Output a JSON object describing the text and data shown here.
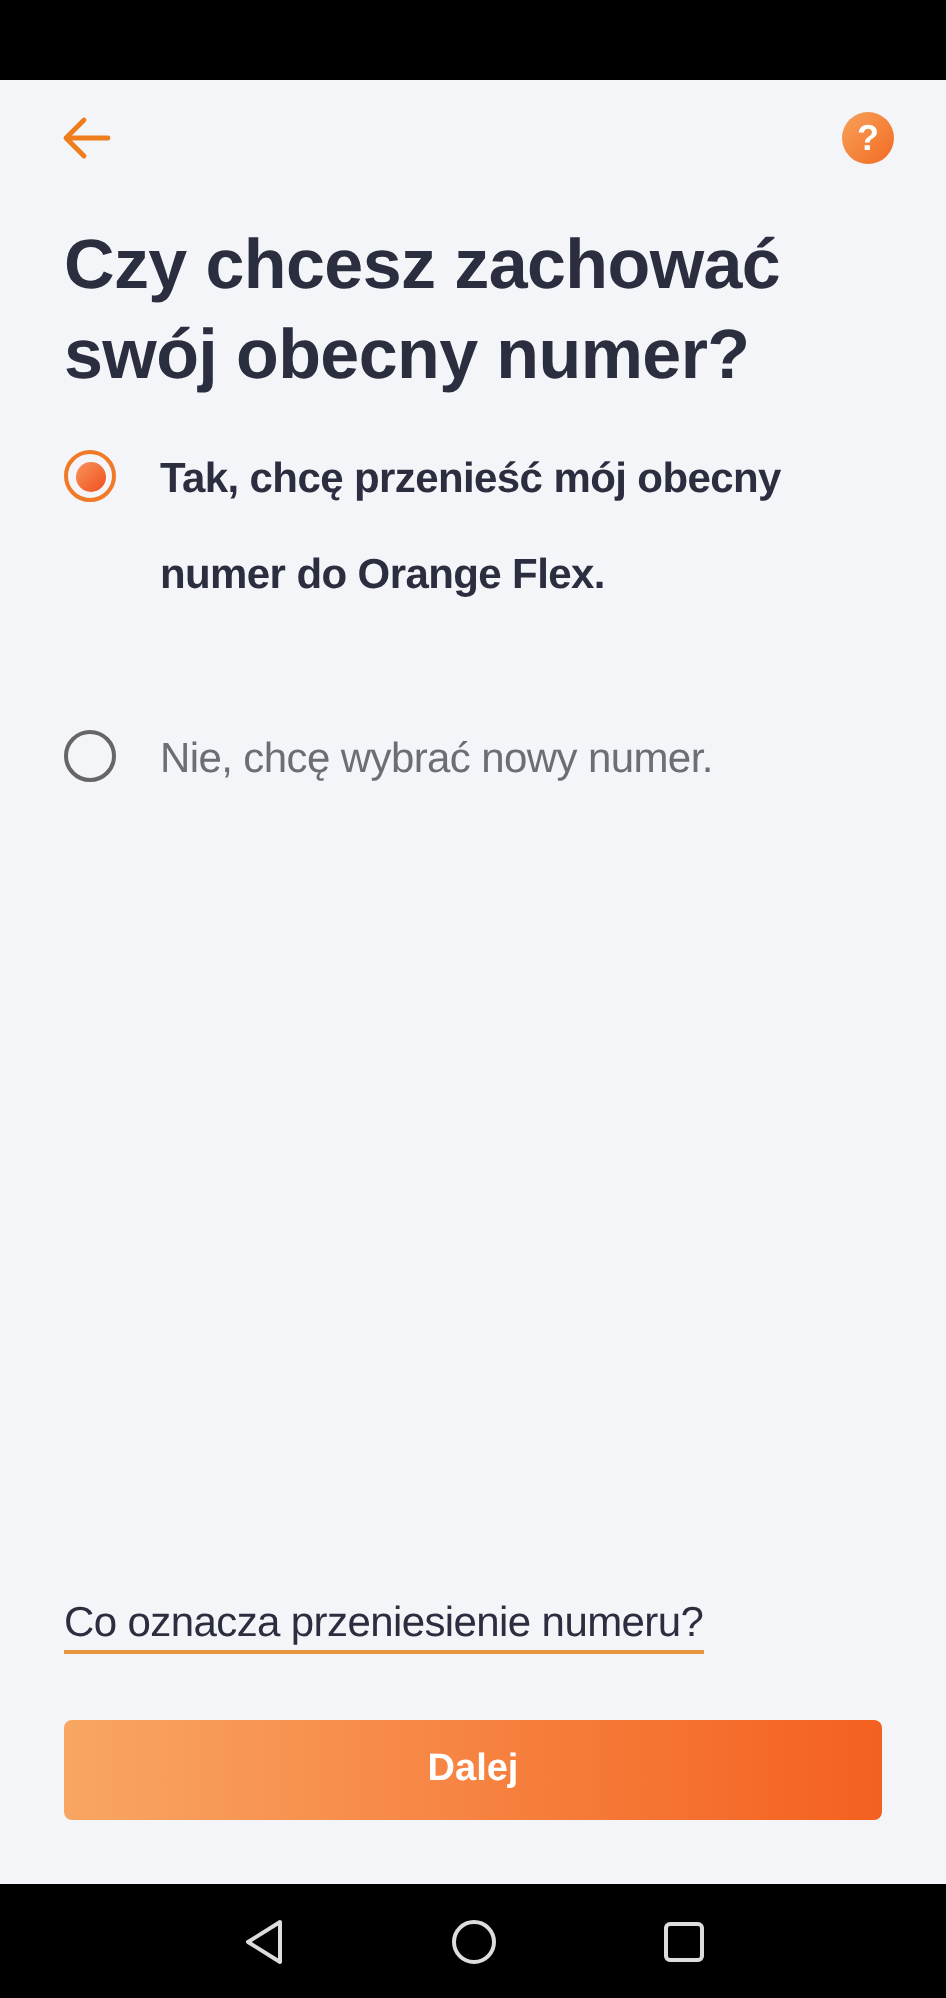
{
  "header": {
    "help_symbol": "?"
  },
  "title": "Czy chcesz zachować swój obecny numer?",
  "options": [
    {
      "label": "Tak, chcę przenieść mój obecny numer do Orange Flex.",
      "selected": true
    },
    {
      "label": "Nie, chcę wybrać nowy numer.",
      "selected": false
    }
  ],
  "link": "Co oznacza przeniesienie numeru?",
  "button": "Dalej"
}
